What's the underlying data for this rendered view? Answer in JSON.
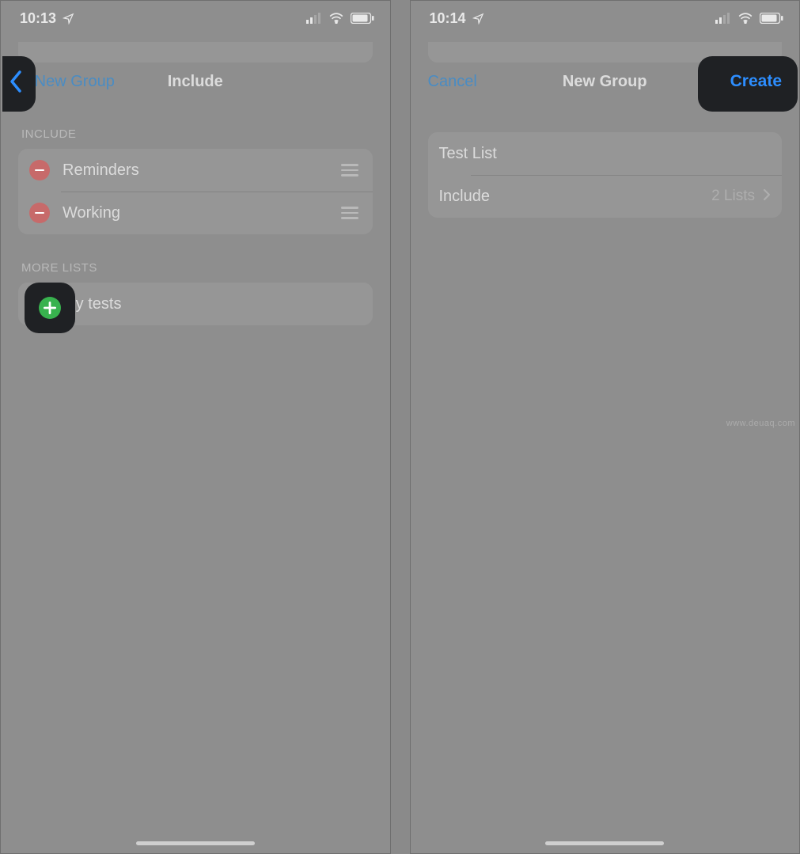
{
  "left": {
    "status": {
      "time": "10:13"
    },
    "nav": {
      "back_label": "New Group",
      "title": "Include"
    },
    "sections": {
      "include_header": "INCLUDE",
      "include_items": [
        {
          "label": "Reminders"
        },
        {
          "label": "Working"
        }
      ],
      "more_header": "MORE LISTS",
      "more_items": [
        {
          "label": "My tests"
        }
      ]
    }
  },
  "right": {
    "status": {
      "time": "10:14"
    },
    "nav": {
      "cancel_label": "Cancel",
      "title": "New Group",
      "create_label": "Create"
    },
    "rows": {
      "name_value": "Test List",
      "include_label": "Include",
      "include_value": "2 Lists"
    }
  },
  "watermark": "www.deuaq.com"
}
